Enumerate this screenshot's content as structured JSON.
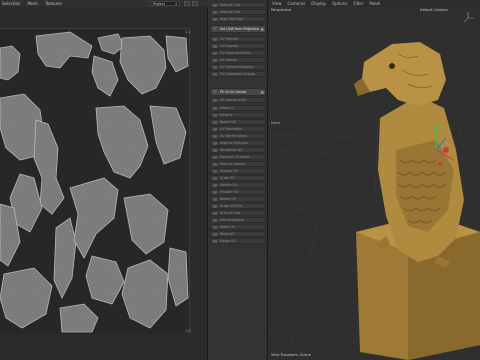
{
  "uv_editor": {
    "menu": [
      "Selection",
      "Mesh",
      "Textures"
    ],
    "project_select": "Project",
    "corner_top_right": "1,1",
    "corner_bottom_right": "1,0"
  },
  "commands": [
    {
      "label": "Snap to Grid"
    },
    {
      "label": "Align to Grid"
    },
    {
      "label": "Align Top Edge"
    },
    {
      "label": "Set UVW from Projection",
      "active": true
    },
    {
      "label": "UV Transfer"
    },
    {
      "label": "UV Unwrap"
    },
    {
      "label": "UV Scale and Relax"
    },
    {
      "label": "UV Islands"
    },
    {
      "label": "UV Optimal Mapping"
    },
    {
      "label": "UV Automatic Unwrap"
    },
    {
      "label": "Fit UV to Canvas",
      "active": true
    },
    {
      "label": "Fit Canvas to UV"
    },
    {
      "label": "Mirror U"
    },
    {
      "label": "Mirror V"
    },
    {
      "label": "Rotate UV"
    },
    {
      "label": "UV Relaxation"
    },
    {
      "label": "UV Terrain Island"
    },
    {
      "label": "Align to Selection"
    },
    {
      "label": "Straighten UV"
    },
    {
      "label": "Equalize UV Island"
    },
    {
      "label": "Pack UV Islands"
    },
    {
      "label": "Unwrap UV"
    },
    {
      "label": "Scale UV"
    },
    {
      "label": "Stretch UV"
    },
    {
      "label": "Transfer UV"
    },
    {
      "label": "Rotate UV"
    },
    {
      "label": "Scale UV Grid"
    },
    {
      "label": "Grid UV Grid"
    },
    {
      "label": "Edit Sequencer"
    },
    {
      "label": "Stitch UV"
    },
    {
      "label": "Relax UV"
    },
    {
      "label": "Merge UV"
    }
  ],
  "viewport": {
    "menu": [
      "View",
      "Cameras",
      "Display",
      "Options",
      "Filter",
      "Panel"
    ],
    "view_name": "Perspective",
    "camera_name": "Default Camera",
    "mode_label": "Move",
    "status_text": "View Transform: Scene"
  },
  "colors": {
    "uv_island": "#7e7e7e",
    "uv_island_edge": "#b5b5b5",
    "statue": "#b08a3e",
    "grid_line": "#3a3a3a"
  }
}
